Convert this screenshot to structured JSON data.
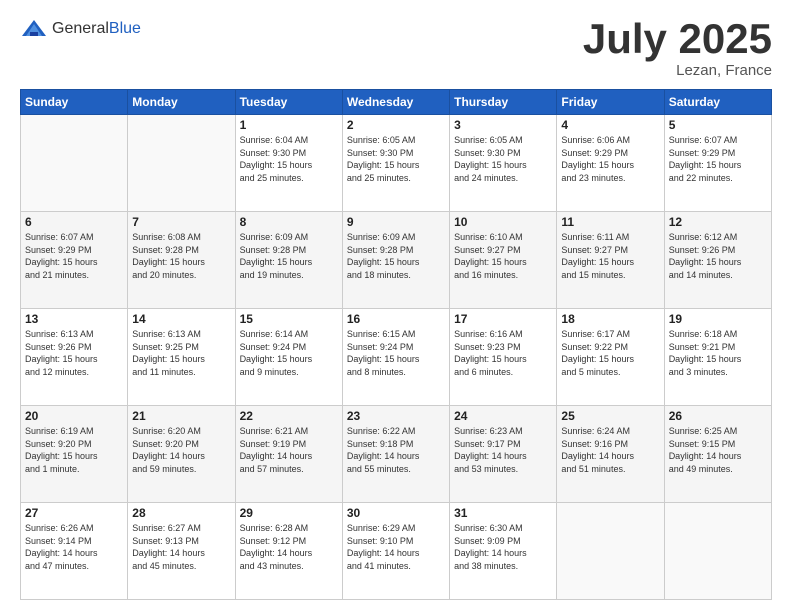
{
  "header": {
    "logo_general": "General",
    "logo_blue": "Blue",
    "month": "July 2025",
    "location": "Lezan, France"
  },
  "days_of_week": [
    "Sunday",
    "Monday",
    "Tuesday",
    "Wednesday",
    "Thursday",
    "Friday",
    "Saturday"
  ],
  "weeks": [
    [
      {
        "day": "",
        "info": ""
      },
      {
        "day": "",
        "info": ""
      },
      {
        "day": "1",
        "info": "Sunrise: 6:04 AM\nSunset: 9:30 PM\nDaylight: 15 hours\nand 25 minutes."
      },
      {
        "day": "2",
        "info": "Sunrise: 6:05 AM\nSunset: 9:30 PM\nDaylight: 15 hours\nand 25 minutes."
      },
      {
        "day": "3",
        "info": "Sunrise: 6:05 AM\nSunset: 9:30 PM\nDaylight: 15 hours\nand 24 minutes."
      },
      {
        "day": "4",
        "info": "Sunrise: 6:06 AM\nSunset: 9:29 PM\nDaylight: 15 hours\nand 23 minutes."
      },
      {
        "day": "5",
        "info": "Sunrise: 6:07 AM\nSunset: 9:29 PM\nDaylight: 15 hours\nand 22 minutes."
      }
    ],
    [
      {
        "day": "6",
        "info": "Sunrise: 6:07 AM\nSunset: 9:29 PM\nDaylight: 15 hours\nand 21 minutes."
      },
      {
        "day": "7",
        "info": "Sunrise: 6:08 AM\nSunset: 9:28 PM\nDaylight: 15 hours\nand 20 minutes."
      },
      {
        "day": "8",
        "info": "Sunrise: 6:09 AM\nSunset: 9:28 PM\nDaylight: 15 hours\nand 19 minutes."
      },
      {
        "day": "9",
        "info": "Sunrise: 6:09 AM\nSunset: 9:28 PM\nDaylight: 15 hours\nand 18 minutes."
      },
      {
        "day": "10",
        "info": "Sunrise: 6:10 AM\nSunset: 9:27 PM\nDaylight: 15 hours\nand 16 minutes."
      },
      {
        "day": "11",
        "info": "Sunrise: 6:11 AM\nSunset: 9:27 PM\nDaylight: 15 hours\nand 15 minutes."
      },
      {
        "day": "12",
        "info": "Sunrise: 6:12 AM\nSunset: 9:26 PM\nDaylight: 15 hours\nand 14 minutes."
      }
    ],
    [
      {
        "day": "13",
        "info": "Sunrise: 6:13 AM\nSunset: 9:26 PM\nDaylight: 15 hours\nand 12 minutes."
      },
      {
        "day": "14",
        "info": "Sunrise: 6:13 AM\nSunset: 9:25 PM\nDaylight: 15 hours\nand 11 minutes."
      },
      {
        "day": "15",
        "info": "Sunrise: 6:14 AM\nSunset: 9:24 PM\nDaylight: 15 hours\nand 9 minutes."
      },
      {
        "day": "16",
        "info": "Sunrise: 6:15 AM\nSunset: 9:24 PM\nDaylight: 15 hours\nand 8 minutes."
      },
      {
        "day": "17",
        "info": "Sunrise: 6:16 AM\nSunset: 9:23 PM\nDaylight: 15 hours\nand 6 minutes."
      },
      {
        "day": "18",
        "info": "Sunrise: 6:17 AM\nSunset: 9:22 PM\nDaylight: 15 hours\nand 5 minutes."
      },
      {
        "day": "19",
        "info": "Sunrise: 6:18 AM\nSunset: 9:21 PM\nDaylight: 15 hours\nand 3 minutes."
      }
    ],
    [
      {
        "day": "20",
        "info": "Sunrise: 6:19 AM\nSunset: 9:20 PM\nDaylight: 15 hours\nand 1 minute."
      },
      {
        "day": "21",
        "info": "Sunrise: 6:20 AM\nSunset: 9:20 PM\nDaylight: 14 hours\nand 59 minutes."
      },
      {
        "day": "22",
        "info": "Sunrise: 6:21 AM\nSunset: 9:19 PM\nDaylight: 14 hours\nand 57 minutes."
      },
      {
        "day": "23",
        "info": "Sunrise: 6:22 AM\nSunset: 9:18 PM\nDaylight: 14 hours\nand 55 minutes."
      },
      {
        "day": "24",
        "info": "Sunrise: 6:23 AM\nSunset: 9:17 PM\nDaylight: 14 hours\nand 53 minutes."
      },
      {
        "day": "25",
        "info": "Sunrise: 6:24 AM\nSunset: 9:16 PM\nDaylight: 14 hours\nand 51 minutes."
      },
      {
        "day": "26",
        "info": "Sunrise: 6:25 AM\nSunset: 9:15 PM\nDaylight: 14 hours\nand 49 minutes."
      }
    ],
    [
      {
        "day": "27",
        "info": "Sunrise: 6:26 AM\nSunset: 9:14 PM\nDaylight: 14 hours\nand 47 minutes."
      },
      {
        "day": "28",
        "info": "Sunrise: 6:27 AM\nSunset: 9:13 PM\nDaylight: 14 hours\nand 45 minutes."
      },
      {
        "day": "29",
        "info": "Sunrise: 6:28 AM\nSunset: 9:12 PM\nDaylight: 14 hours\nand 43 minutes."
      },
      {
        "day": "30",
        "info": "Sunrise: 6:29 AM\nSunset: 9:10 PM\nDaylight: 14 hours\nand 41 minutes."
      },
      {
        "day": "31",
        "info": "Sunrise: 6:30 AM\nSunset: 9:09 PM\nDaylight: 14 hours\nand 38 minutes."
      },
      {
        "day": "",
        "info": ""
      },
      {
        "day": "",
        "info": ""
      }
    ]
  ]
}
